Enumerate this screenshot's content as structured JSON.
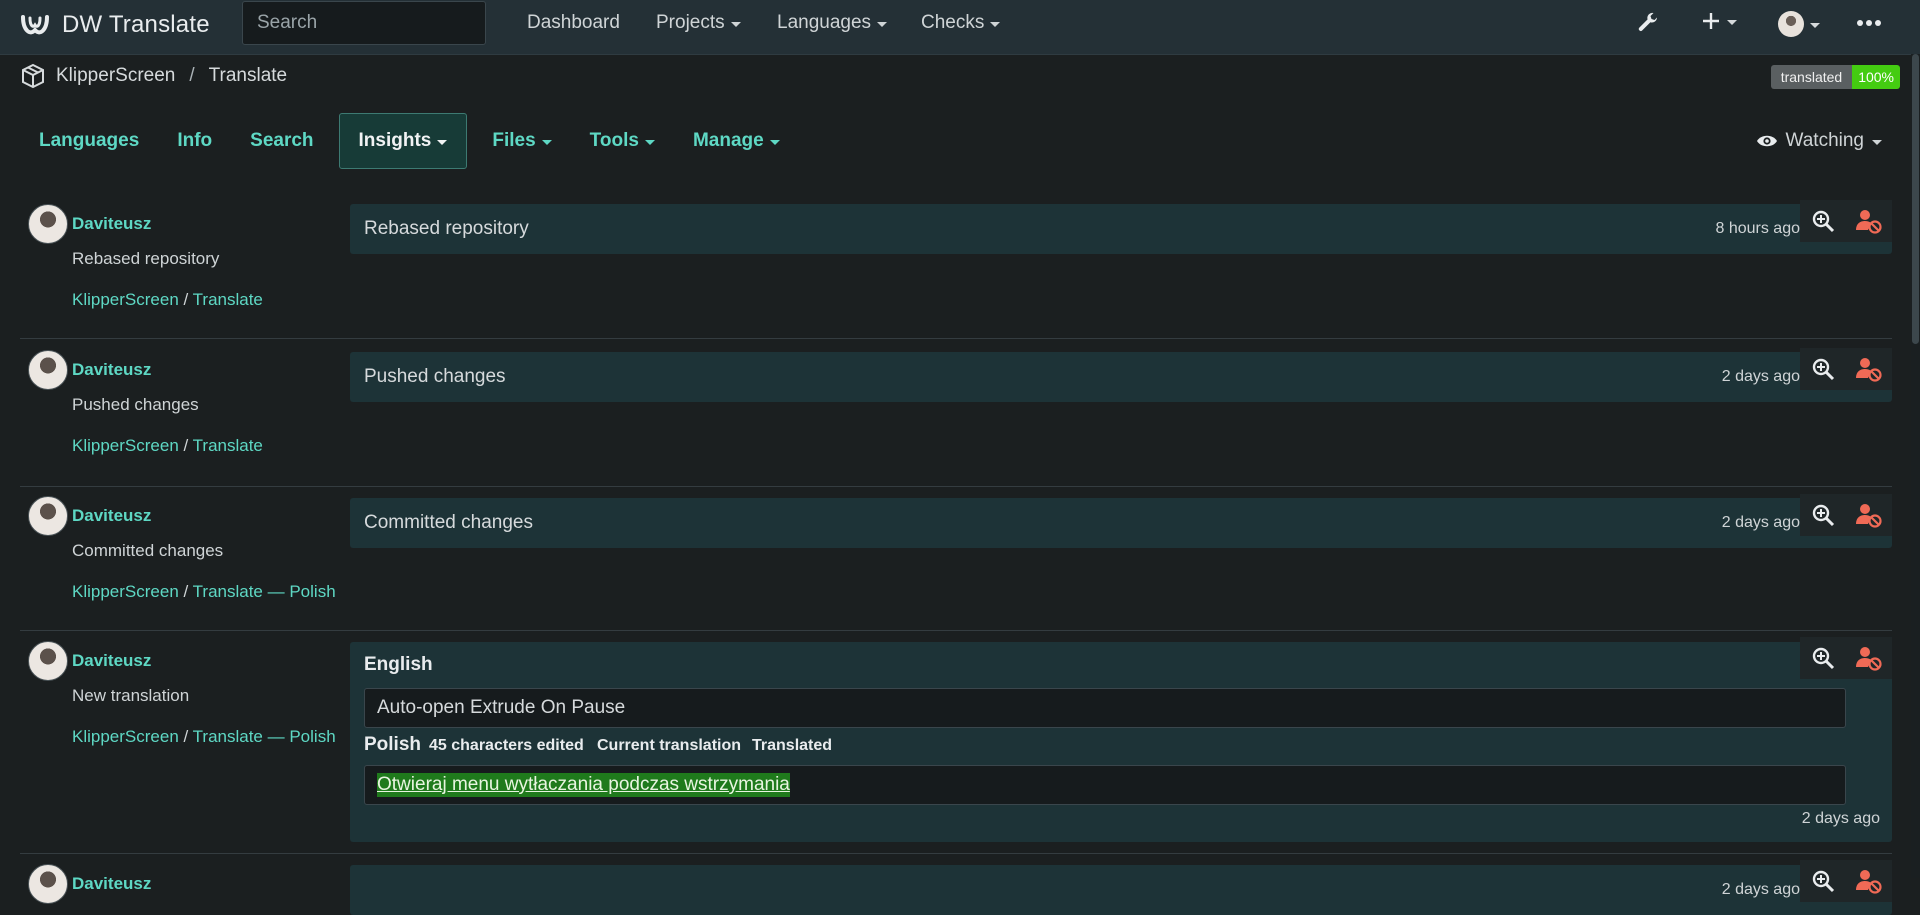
{
  "app": {
    "name": "DW Translate"
  },
  "nav": {
    "search_placeholder": "Search",
    "links": [
      "Dashboard",
      "Projects",
      "Languages",
      "Checks"
    ]
  },
  "breadcrumb": {
    "project": "KlipperScreen",
    "separator": "/",
    "component": "Translate"
  },
  "badge": {
    "label": "translated",
    "value": "100%"
  },
  "tabs": [
    "Languages",
    "Info",
    "Search",
    "Insights",
    "Files",
    "Tools",
    "Manage"
  ],
  "watching": "Watching",
  "entries": [
    {
      "user": "Daviteusz",
      "action": "Rebased repository",
      "project": "KlipperScreen",
      "component": "Translate",
      "language": "",
      "summary": "Rebased repository",
      "time": "8 hours ago"
    },
    {
      "user": "Daviteusz",
      "action": "Pushed changes",
      "project": "KlipperScreen",
      "component": "Translate",
      "language": "",
      "summary": "Pushed changes",
      "time": "2 days ago"
    },
    {
      "user": "Daviteusz",
      "action": "Committed changes",
      "project": "KlipperScreen",
      "component": "Translate",
      "language": "— Polish",
      "summary": "Committed changes",
      "time": "2 days ago"
    },
    {
      "user": "Daviteusz",
      "action": "New translation",
      "project": "KlipperScreen",
      "component": "Translate",
      "language": "— Polish",
      "source_lang": "English",
      "source_text": "Auto-open Extrude On Pause",
      "target_lang": "Polish",
      "chars_edited": "45 characters edited",
      "state_current": "Current translation",
      "state": "Translated",
      "target_text": "Otwieraj menu wytłaczania podczas wstrzymania",
      "time": "2 days ago"
    },
    {
      "user": "Daviteusz",
      "time": "2 days ago"
    }
  ],
  "colors": {
    "accent": "#5ed8c4",
    "danger": "#f06a56",
    "badge_green": "#44cc11"
  }
}
